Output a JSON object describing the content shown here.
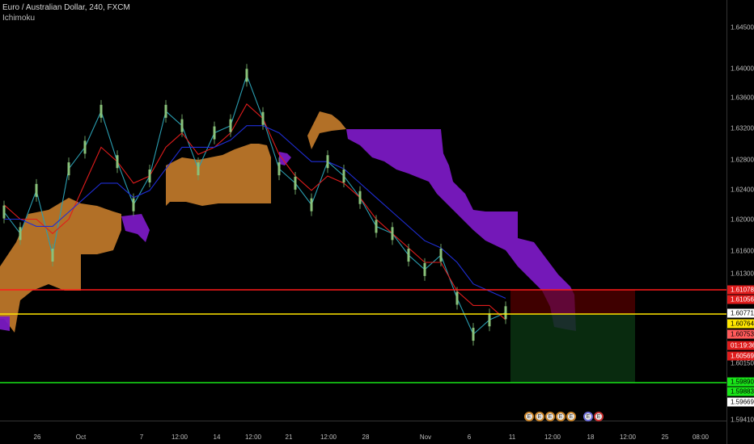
{
  "header": {
    "title": "Euro / Australian Dollar, 240, FXCM",
    "indicator": "Ichimoku"
  },
  "colors": {
    "kumo_bull": "#c17a2a",
    "kumo_bear": "#7a19c2",
    "tenkan": "#e01c1c",
    "kijun": "#1f2ed6",
    "chikou": "#2a9db0",
    "candles": "#8ac27a",
    "level_red": "#ff1a1a",
    "level_yellow": "#ffe600",
    "level_green": "#19e619"
  },
  "yaxis": {
    "ticks": [
      "1.64500",
      "1.64000",
      "1.63600",
      "1.63200",
      "1.62800",
      "1.62400",
      "1.62000",
      "1.61600",
      "1.61300",
      "1.60150",
      "1.59410"
    ]
  },
  "xaxis": {
    "ticks": [
      "26",
      "Oct",
      "7",
      "12:00",
      "14",
      "12:00",
      "21",
      "12:00",
      "28",
      "Nov",
      "6",
      "11",
      "12:00",
      "18",
      "12:00",
      "25",
      "08:00"
    ]
  },
  "price_tags": [
    {
      "label": "1.61078",
      "bg": "#e01c1c",
      "fg": "#ffffff"
    },
    {
      "label": "1.61056",
      "bg": "#e01c1c",
      "fg": "#ffffff"
    },
    {
      "label": "1.60771",
      "bg": "#ffffff",
      "fg": "#000000"
    },
    {
      "label": "1.60764",
      "bg": "#ffe600",
      "fg": "#000000"
    },
    {
      "label": "1.60753",
      "bg": "#ff5a5a",
      "fg": "#000000"
    },
    {
      "label": "01:19:36",
      "bg": "#e01c1c",
      "fg": "#ffffff"
    },
    {
      "label": "1.60569",
      "bg": "#e01c1c",
      "fg": "#ffffff"
    },
    {
      "label": "1.59890",
      "bg": "#19e619",
      "fg": "#000000"
    },
    {
      "label": "1.59883",
      "bg": "#19e619",
      "fg": "#000000"
    },
    {
      "label": "1.59669",
      "bg": "#ffffff",
      "fg": "#000000"
    }
  ],
  "events": [
    {
      "label": "E",
      "style": "orange"
    },
    {
      "label": "E",
      "style": "orange"
    },
    {
      "label": "E",
      "style": "orange"
    },
    {
      "label": "E",
      "style": "orange"
    },
    {
      "label": "E",
      "style": "orange"
    },
    {
      "label": "E",
      "style": "blue"
    },
    {
      "label": "E",
      "style": "red"
    }
  ],
  "chart_data": {
    "type": "line",
    "title": "Euro / Australian Dollar, 240, FXCM",
    "ylim": [
      1.592,
      1.648
    ],
    "x": [
      0,
      20,
      40,
      60,
      80,
      100,
      120,
      140,
      160,
      180,
      200,
      220,
      240,
      260,
      280,
      300,
      320,
      340,
      360,
      380,
      400,
      420,
      440,
      460,
      480,
      500,
      520,
      540,
      560,
      580,
      600,
      620
    ],
    "series": [
      {
        "name": "price",
        "values": [
          1.621,
          1.618,
          1.624,
          1.615,
          1.627,
          1.63,
          1.635,
          1.628,
          1.622,
          1.626,
          1.635,
          1.633,
          1.627,
          1.632,
          1.633,
          1.64,
          1.634,
          1.627,
          1.625,
          1.622,
          1.628,
          1.626,
          1.623,
          1.619,
          1.618,
          1.615,
          1.613,
          1.615,
          1.609,
          1.604,
          1.606,
          1.607
        ]
      },
      {
        "name": "tenkan",
        "values": [
          1.622,
          1.62,
          1.62,
          1.618,
          1.62,
          1.625,
          1.63,
          1.628,
          1.625,
          1.626,
          1.63,
          1.632,
          1.629,
          1.63,
          1.632,
          1.636,
          1.634,
          1.629,
          1.626,
          1.624,
          1.626,
          1.625,
          1.623,
          1.62,
          1.618,
          1.616,
          1.614,
          1.614,
          1.61,
          1.608,
          1.608,
          1.606
        ]
      },
      {
        "name": "kijun",
        "values": [
          1.62,
          1.62,
          1.619,
          1.619,
          1.621,
          1.623,
          1.625,
          1.625,
          1.623,
          1.624,
          1.627,
          1.63,
          1.63,
          1.63,
          1.631,
          1.633,
          1.633,
          1.632,
          1.63,
          1.628,
          1.628,
          1.627,
          1.625,
          1.623,
          1.621,
          1.619,
          1.617,
          1.616,
          1.614,
          1.611,
          1.61,
          1.609
        ]
      }
    ],
    "levels": [
      1.61078,
      1.60771,
      1.5989
    ],
    "grid": false
  }
}
